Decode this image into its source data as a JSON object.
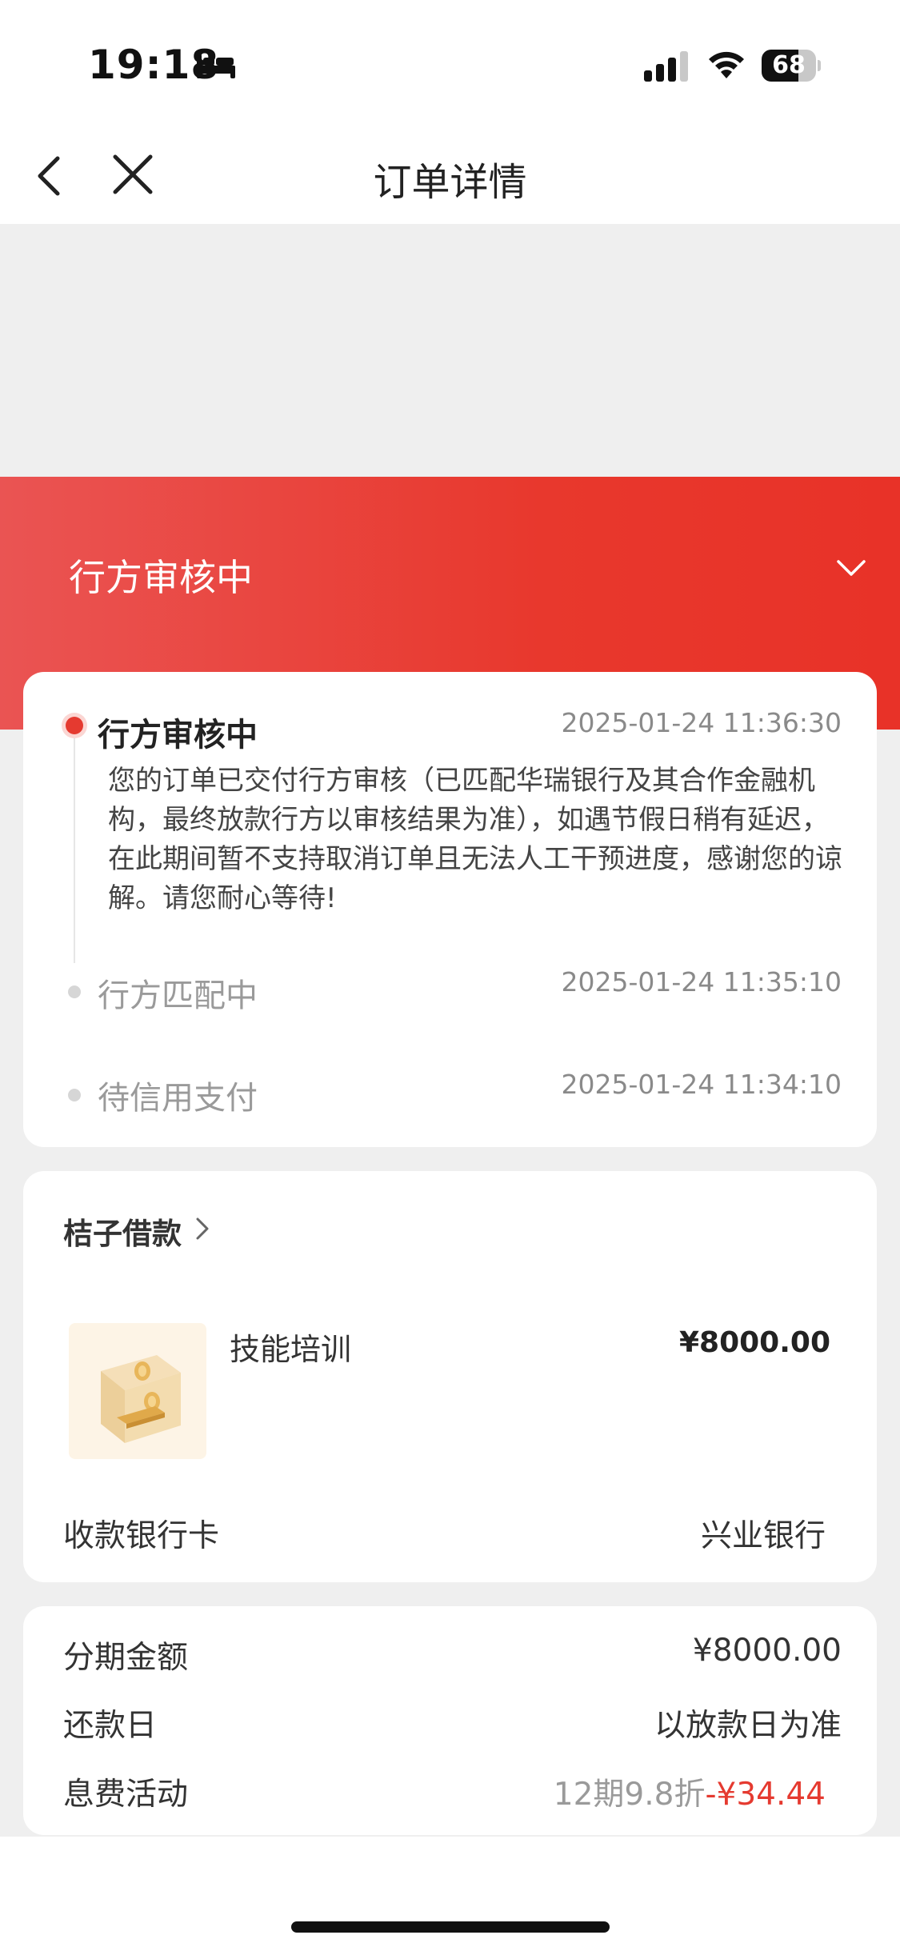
{
  "status_bar": {
    "time": "19:18",
    "battery": "68",
    "battery_level": 0.68
  },
  "nav": {
    "title": "订单详情"
  },
  "header": {
    "title": "行方审核中"
  },
  "timeline": [
    {
      "title": "行方审核中",
      "time": "2025-01-24 11:36:30",
      "active": true,
      "desc": "您的订单已交付行方审核（已匹配华瑞银行及其合作金融机构，最终放款行方以审核结果为准），如遇节假日稍有延迟，在此期间暂不支持取消订单且无法人工干预进度，感谢您的谅解。请您耐心等待!"
    },
    {
      "title": "行方匹配中",
      "time": "2025-01-24 11:35:10",
      "active": false
    },
    {
      "title": "待信用支付",
      "time": "2025-01-24 11:34:10",
      "active": false
    }
  ],
  "product": {
    "merchant": "桔子借款",
    "name": "技能培训",
    "price": "¥8000.00",
    "bank_label": "收款银行卡",
    "bank_value": "兴业银行"
  },
  "installment": {
    "amount_label": "分期金额",
    "amount_value": "¥8000.00",
    "repay_label": "还款日",
    "repay_value": "以放款日为准",
    "fee_label": "息费活动",
    "fee_discount": "12期9.8折",
    "fee_saving": "-¥34.44"
  },
  "colors": {
    "accent_red": "#e53a30",
    "header_gradient_start": "#ea5453",
    "header_gradient_end": "#e83228"
  },
  "icons": [
    "bed-icon",
    "signal-icon",
    "wifi-icon",
    "battery-icon",
    "back-icon",
    "close-icon",
    "chevron-down-icon",
    "chevron-right-icon",
    "coin-box-icon"
  ]
}
